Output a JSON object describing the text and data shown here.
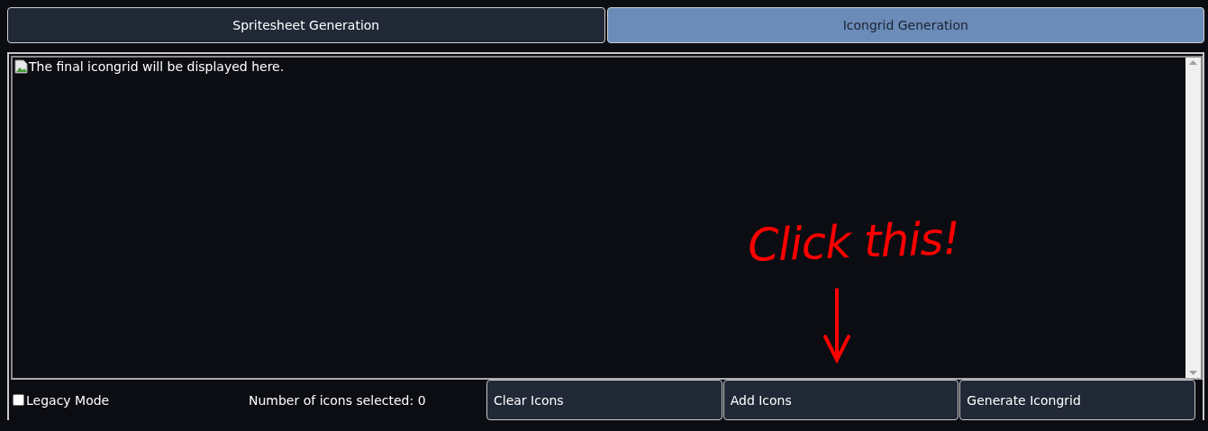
{
  "tabs": [
    {
      "label": "Spritesheet Generation",
      "selected": false
    },
    {
      "label": "Icongrid Generation",
      "selected": true
    }
  ],
  "preview": {
    "alt_text": "The final icongrid will be displayed here."
  },
  "annotation": {
    "text": "Click this!"
  },
  "controls": {
    "legacy_mode": {
      "label": "Legacy Mode",
      "checked": false
    },
    "counter": "Number of icons selected: 0",
    "buttons": [
      "Clear Icons",
      "Add Icons",
      "Generate Icongrid"
    ]
  }
}
